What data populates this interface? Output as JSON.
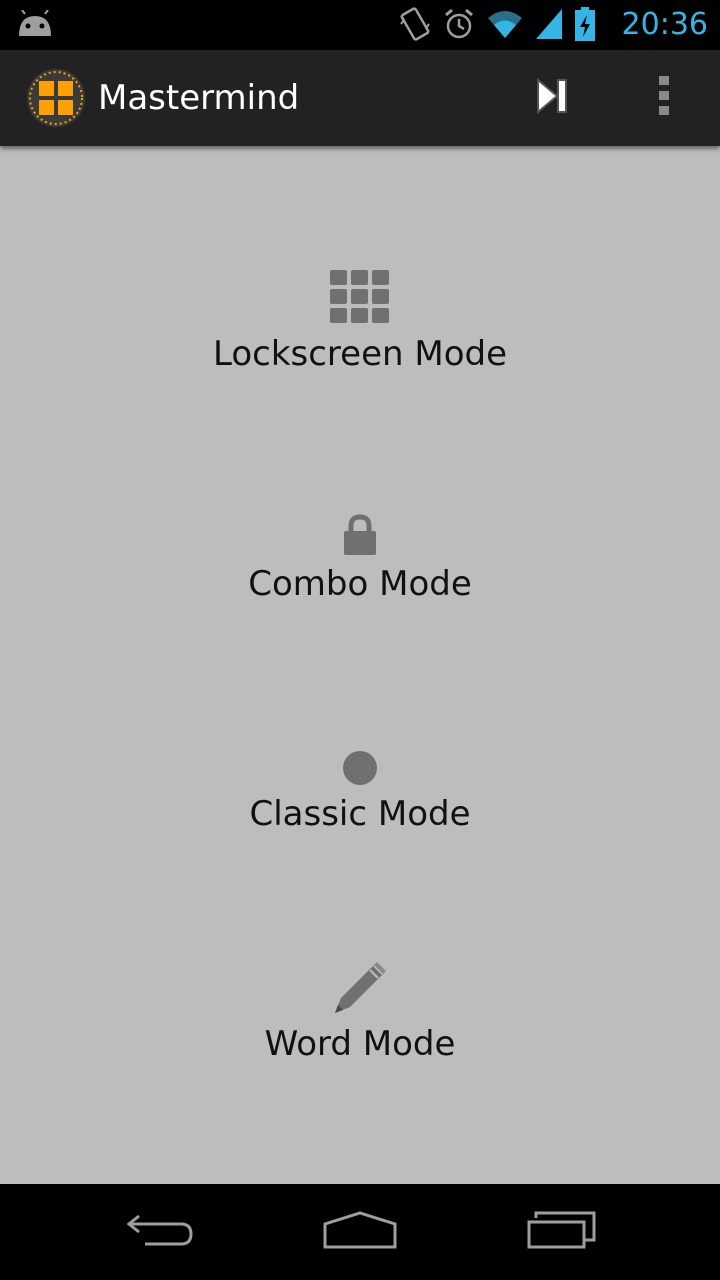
{
  "status_bar": {
    "time": "20:36",
    "icons": [
      "android-debug-icon",
      "vibrate-icon",
      "alarm-icon",
      "wifi-icon",
      "signal-icon",
      "battery-charging-icon"
    ]
  },
  "action_bar": {
    "title": "Mastermind",
    "logo_icon": "mastermind-logo-icon",
    "actions": [
      "skip-next-icon",
      "overflow-menu-icon"
    ]
  },
  "modes": [
    {
      "label": "Lockscreen Mode",
      "icon": "grid-icon"
    },
    {
      "label": "Combo Mode",
      "icon": "lock-icon"
    },
    {
      "label": "Classic Mode",
      "icon": "circle-icon"
    },
    {
      "label": "Word Mode",
      "icon": "pencil-icon"
    }
  ],
  "nav_bar": {
    "buttons": [
      "back-icon",
      "home-icon",
      "recents-icon"
    ]
  },
  "colors": {
    "background": "#bdbdbd",
    "action_bar": "#222222",
    "status_time": "#33b5e5",
    "icon_gray": "#707070",
    "logo_orange": "#ffa000"
  }
}
